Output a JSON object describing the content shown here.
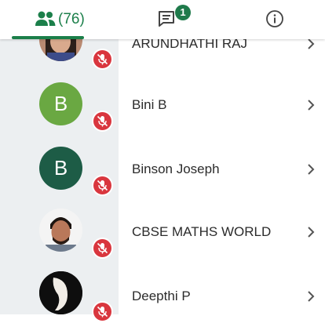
{
  "tabs": {
    "participants_count": "(76)",
    "chat_badge": "1"
  },
  "colors": {
    "accent": "#1b7f4a",
    "muted_mic": "#d9363e",
    "bini_avatar": "#6aa842",
    "binson_avatar": "#1d5c46"
  },
  "participants": [
    {
      "name": "ARUNDHATHI RAJ",
      "avatar": "photo",
      "mic": "muted"
    },
    {
      "name": "Bini B",
      "avatar_letter": "B",
      "mic": "muted"
    },
    {
      "name": "Binson Joseph",
      "avatar_letter": "B",
      "mic": "muted"
    },
    {
      "name": "CBSE MATHS WORLD",
      "avatar": "photo",
      "mic": "muted"
    },
    {
      "name": "Deepthi P",
      "avatar": "photo",
      "mic": "muted"
    }
  ]
}
